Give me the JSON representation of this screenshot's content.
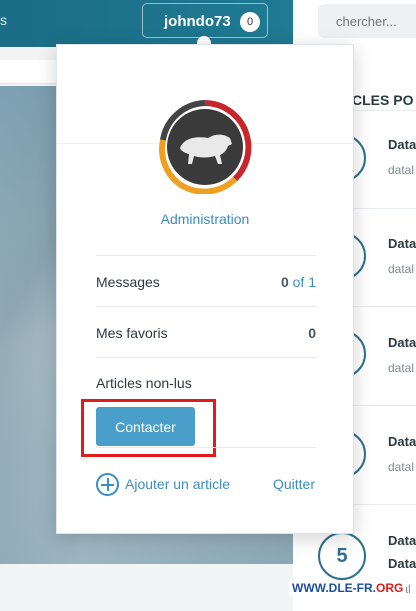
{
  "header": {
    "left_fragment": "s",
    "username": "johndo73",
    "notif_count": "0",
    "search_placeholder": "chercher..."
  },
  "sidebar": {
    "title_fragment": "CLES PO",
    "items": [
      {
        "rank": "",
        "line1": "Data",
        "line2": "datal"
      },
      {
        "rank": "",
        "line1": "Data",
        "line2": "datal"
      },
      {
        "rank": "",
        "line1": "Data",
        "line2": "datal"
      },
      {
        "rank": "",
        "line1": "Data",
        "line2": "datal"
      },
      {
        "rank": "5",
        "line1": "Data",
        "line2": "Data"
      }
    ],
    "last_extra": "tal"
  },
  "dropdown": {
    "group": "Administration",
    "rows": [
      {
        "label": "Messages",
        "value": "0",
        "value_suffix": "of 1"
      },
      {
        "label": "Mes favoris",
        "value": "0",
        "value_suffix": ""
      },
      {
        "label": "Articles non-lus",
        "value": "",
        "value_suffix": ""
      }
    ],
    "contact_button": "Contacter",
    "add_article": "Ajouter un article",
    "quit": "Quitter"
  },
  "watermark": {
    "main": "WWW.DLE-FR.",
    "tld": "ORG"
  },
  "colors": {
    "accent": "#3b8ec2",
    "header": "#1f6f8b",
    "highlight": "#e01b1b"
  }
}
